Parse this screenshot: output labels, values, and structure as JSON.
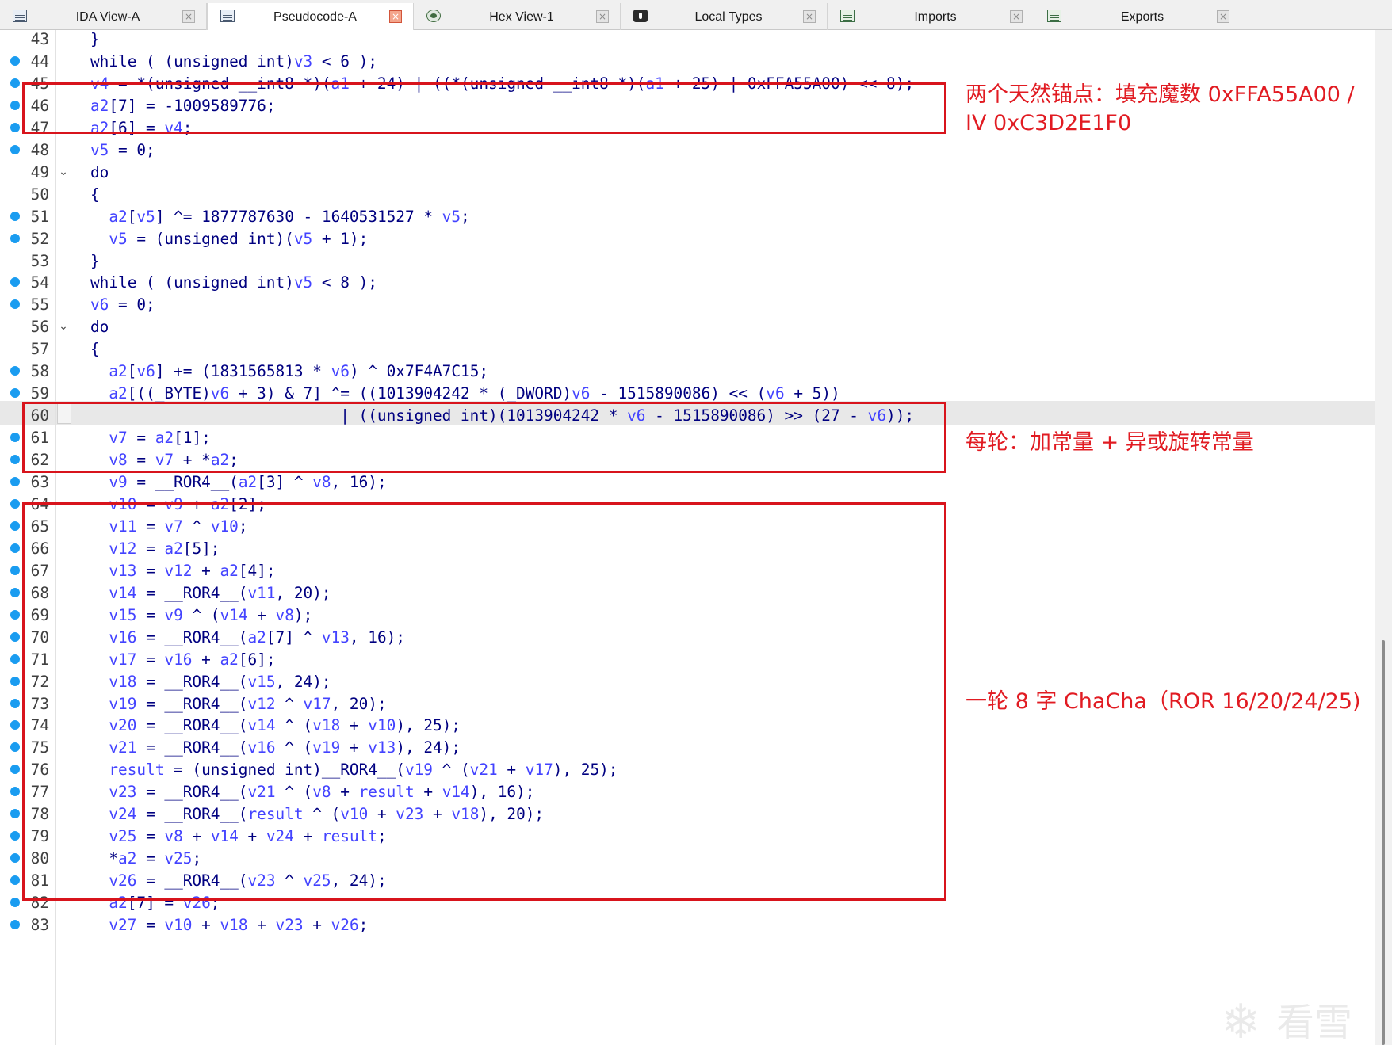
{
  "tabs": [
    {
      "label": "IDA View-A",
      "icon": "ida-view-icon",
      "active": false
    },
    {
      "label": "Pseudocode-A",
      "icon": "pseudocode-icon",
      "active": true
    },
    {
      "label": "Hex View-1",
      "icon": "hex-view-icon",
      "active": false
    },
    {
      "label": "Local Types",
      "icon": "local-types-icon",
      "active": false
    },
    {
      "label": "Imports",
      "icon": "imports-icon",
      "active": false
    },
    {
      "label": "Exports",
      "icon": "exports-icon",
      "active": false
    }
  ],
  "tab_close_glyph": "×",
  "fold_glyph": "⌄",
  "colors": {
    "annotation_red": "#d8141c",
    "breakpoint_dot": "#1a9cf0",
    "code_default": "#000080",
    "variable": "#4343ff"
  },
  "code_lines": [
    {
      "num": "43",
      "dot": false,
      "fold": false,
      "code": "}"
    },
    {
      "num": "44",
      "dot": true,
      "fold": false,
      "code": "while ( (unsigned int)v3 < 6 );"
    },
    {
      "num": "45",
      "dot": true,
      "fold": false,
      "code": "v4 = *(unsigned __int8 *)(a1 + 24) | ((*(unsigned __int8 *)(a1 + 25) | 0xFFA55A00) << 8);"
    },
    {
      "num": "46",
      "dot": true,
      "fold": false,
      "code": "a2[7] = -1009589776;"
    },
    {
      "num": "47",
      "dot": true,
      "fold": false,
      "code": "a2[6] = v4;"
    },
    {
      "num": "48",
      "dot": true,
      "fold": false,
      "code": "v5 = 0;"
    },
    {
      "num": "49",
      "dot": false,
      "fold": true,
      "code": "do"
    },
    {
      "num": "50",
      "dot": false,
      "fold": false,
      "code": "{"
    },
    {
      "num": "51",
      "dot": true,
      "fold": false,
      "code": "  a2[v5] ^= 1877787630 - 1640531527 * v5;"
    },
    {
      "num": "52",
      "dot": true,
      "fold": false,
      "code": "  v5 = (unsigned int)(v5 + 1);"
    },
    {
      "num": "53",
      "dot": false,
      "fold": false,
      "code": "}"
    },
    {
      "num": "54",
      "dot": true,
      "fold": false,
      "code": "while ( (unsigned int)v5 < 8 );"
    },
    {
      "num": "55",
      "dot": true,
      "fold": false,
      "code": "v6 = 0;"
    },
    {
      "num": "56",
      "dot": false,
      "fold": true,
      "code": "do"
    },
    {
      "num": "57",
      "dot": false,
      "fold": false,
      "code": "{"
    },
    {
      "num": "58",
      "dot": true,
      "fold": false,
      "code": "  a2[v6] += (1831565813 * v6) ^ 0x7F4A7C15;"
    },
    {
      "num": "59",
      "dot": true,
      "fold": false,
      "code": "  a2[((_BYTE)v6 + 3) & 7] ^= ((1013904242 * (_DWORD)v6 - 1515890086) << (v6 + 5))"
    },
    {
      "num": "60",
      "dot": false,
      "fold": false,
      "code": "                           | ((unsigned int)(1013904242 * v6 - 1515890086) >> (27 - v6));"
    },
    {
      "num": "61",
      "dot": true,
      "fold": false,
      "code": "  v7 = a2[1];"
    },
    {
      "num": "62",
      "dot": true,
      "fold": false,
      "code": "  v8 = v7 + *a2;"
    },
    {
      "num": "63",
      "dot": true,
      "fold": false,
      "code": "  v9 = __ROR4__(a2[3] ^ v8, 16);"
    },
    {
      "num": "64",
      "dot": true,
      "fold": false,
      "code": "  v10 = v9 + a2[2];"
    },
    {
      "num": "65",
      "dot": true,
      "fold": false,
      "code": "  v11 = v7 ^ v10;"
    },
    {
      "num": "66",
      "dot": true,
      "fold": false,
      "code": "  v12 = a2[5];"
    },
    {
      "num": "67",
      "dot": true,
      "fold": false,
      "code": "  v13 = v12 + a2[4];"
    },
    {
      "num": "68",
      "dot": true,
      "fold": false,
      "code": "  v14 = __ROR4__(v11, 20);"
    },
    {
      "num": "69",
      "dot": true,
      "fold": false,
      "code": "  v15 = v9 ^ (v14 + v8);"
    },
    {
      "num": "70",
      "dot": true,
      "fold": false,
      "code": "  v16 = __ROR4__(a2[7] ^ v13, 16);"
    },
    {
      "num": "71",
      "dot": true,
      "fold": false,
      "code": "  v17 = v16 + a2[6];"
    },
    {
      "num": "72",
      "dot": true,
      "fold": false,
      "code": "  v18 = __ROR4__(v15, 24);"
    },
    {
      "num": "73",
      "dot": true,
      "fold": false,
      "code": "  v19 = __ROR4__(v12 ^ v17, 20);"
    },
    {
      "num": "74",
      "dot": true,
      "fold": false,
      "code": "  v20 = __ROR4__(v14 ^ (v18 + v10), 25);"
    },
    {
      "num": "75",
      "dot": true,
      "fold": false,
      "code": "  v21 = __ROR4__(v16 ^ (v19 + v13), 24);"
    },
    {
      "num": "76",
      "dot": true,
      "fold": false,
      "code": "  result = (unsigned int)__ROR4__(v19 ^ (v21 + v17), 25);"
    },
    {
      "num": "77",
      "dot": true,
      "fold": false,
      "code": "  v23 = __ROR4__(v21 ^ (v8 + result + v14), 16);"
    },
    {
      "num": "78",
      "dot": true,
      "fold": false,
      "code": "  v24 = __ROR4__(result ^ (v10 + v23 + v18), 20);"
    },
    {
      "num": "79",
      "dot": true,
      "fold": false,
      "code": "  v25 = v8 + v14 + v24 + result;"
    },
    {
      "num": "80",
      "dot": true,
      "fold": false,
      "code": "  *a2 = v25;"
    },
    {
      "num": "81",
      "dot": true,
      "fold": false,
      "code": "  v26 = __ROR4__(v23 ^ v25, 24);"
    },
    {
      "num": "82",
      "dot": true,
      "fold": false,
      "code": "  a2[7] = v26;"
    },
    {
      "num": "83",
      "dot": true,
      "fold": false,
      "code": "  v27 = v10 + v18 + v23 + v26;"
    }
  ],
  "annotations": [
    {
      "lines": [
        "两个天然锚点：填充魔数 0xFFA55A00 /",
        "IV 0xC3D2E1F0"
      ]
    },
    {
      "lines": [
        "每轮：加常量 + 异或旋转常量"
      ]
    },
    {
      "lines": [
        "一轮 8 字 ChaCha（ROR 16/20/24/25)"
      ]
    }
  ],
  "watermark": {
    "icon": "snowflake-icon",
    "glyph": "❄",
    "text": "看雪"
  }
}
